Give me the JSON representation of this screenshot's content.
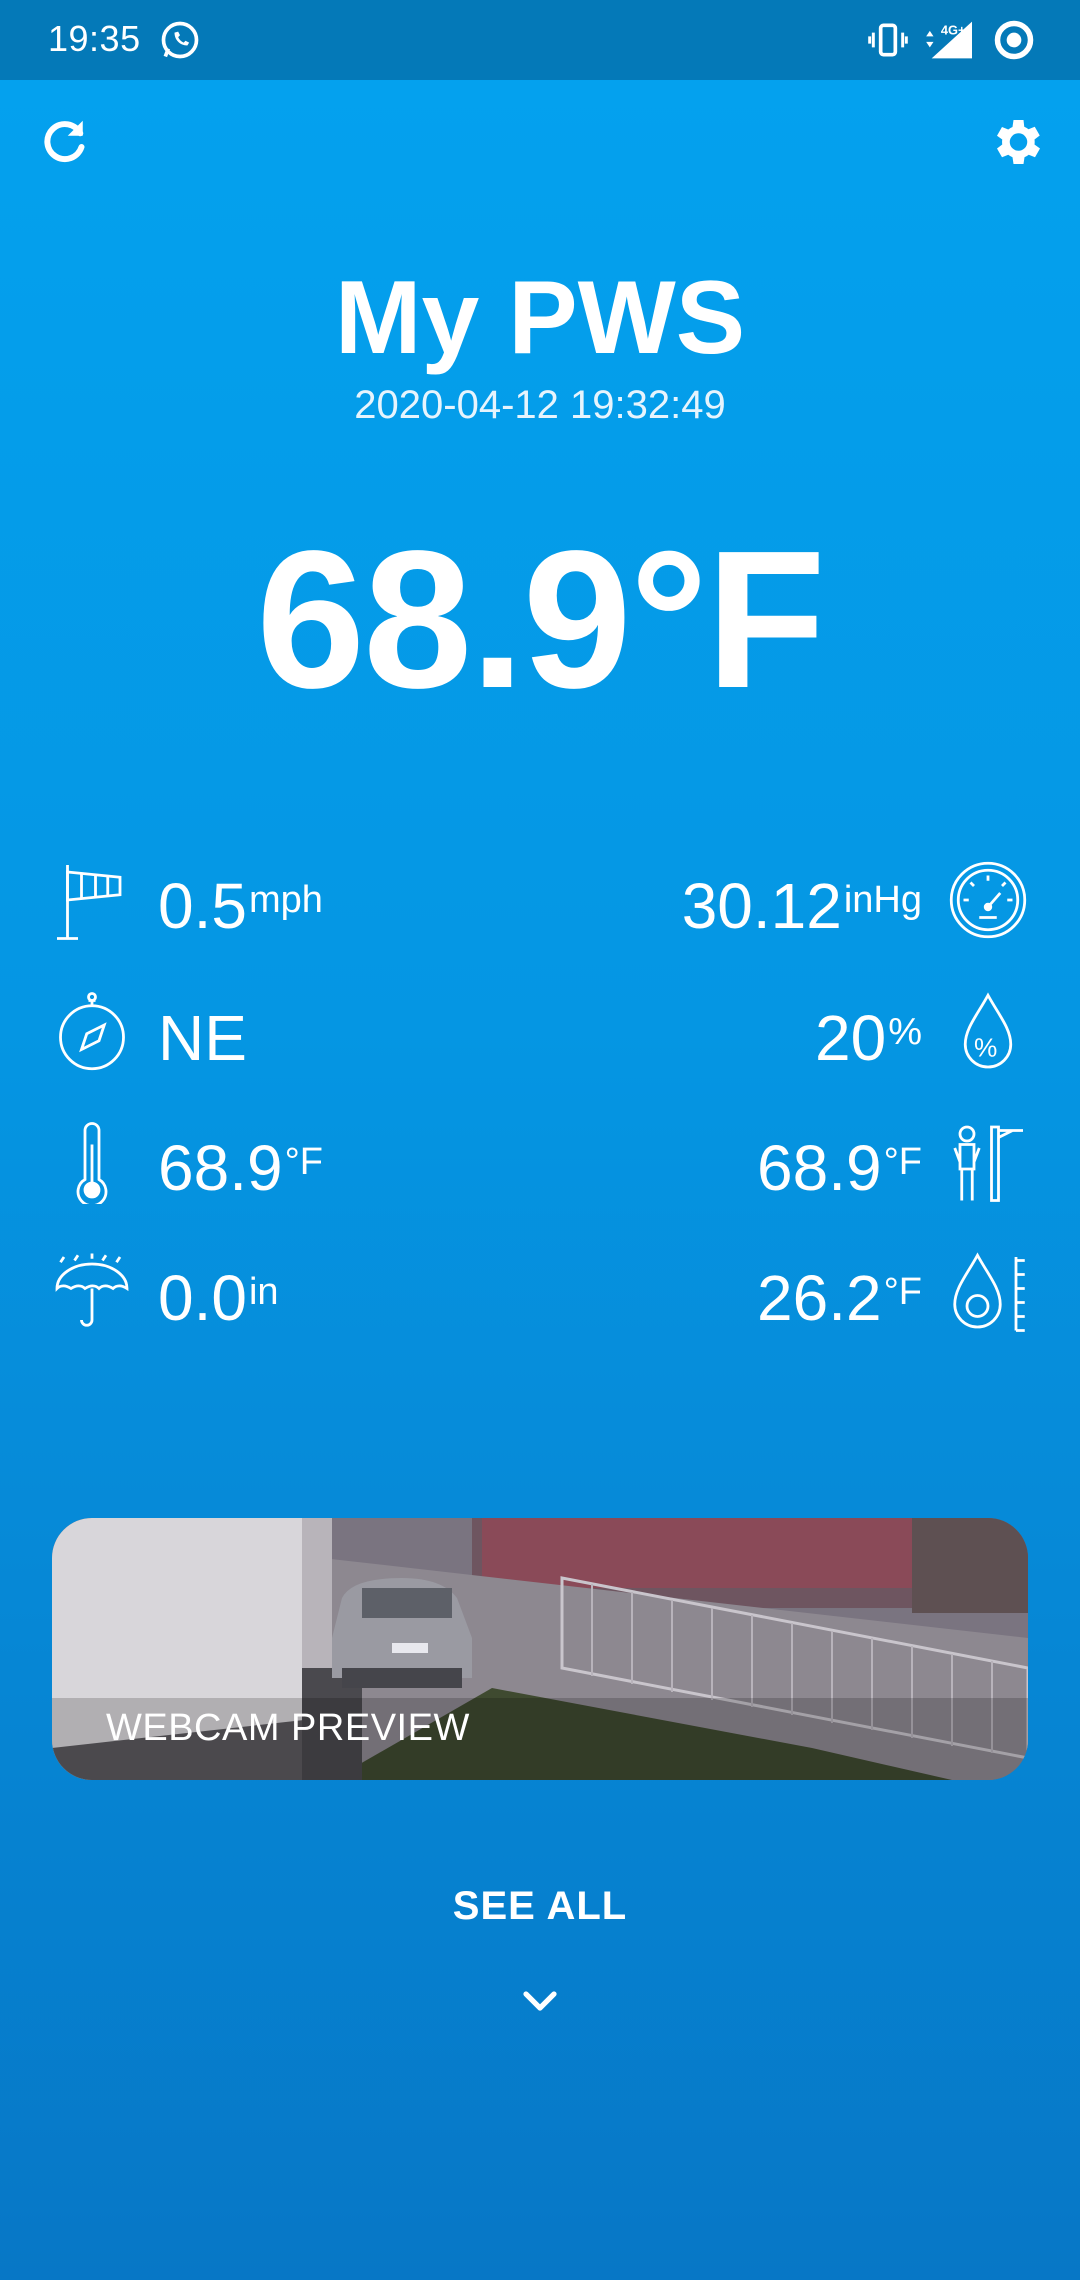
{
  "status_bar": {
    "time": "19:35",
    "icons": [
      "whatsapp-icon",
      "vibrate-icon",
      "signal-4g-icon",
      "sync-circle-icon"
    ],
    "network_label": "4G+"
  },
  "toolbar": {
    "refresh_icon": "refresh-icon",
    "settings_icon": "gear-icon"
  },
  "station": {
    "name": "My PWS",
    "timestamp": "2020-04-12 19:32:49",
    "temperature": "68.9°F"
  },
  "metrics": {
    "wind_speed": {
      "value": "0.5",
      "unit": "mph",
      "icon": "windsock-icon"
    },
    "pressure": {
      "value": "30.12",
      "unit": "inHg",
      "icon": "barometer-icon"
    },
    "wind_direction": {
      "value": "NE",
      "unit": "",
      "icon": "compass-icon"
    },
    "humidity": {
      "value": "20",
      "unit": "%",
      "icon": "humidity-drop-icon"
    },
    "temperature": {
      "value": "68.9",
      "unit": "°F",
      "icon": "thermometer-icon"
    },
    "feels_like": {
      "value": "68.9",
      "unit": "°F",
      "icon": "feels-like-icon"
    },
    "rain": {
      "value": "0.0",
      "unit": "in",
      "icon": "umbrella-rain-icon"
    },
    "dew_point": {
      "value": "26.2",
      "unit": "°F",
      "icon": "dew-point-icon"
    }
  },
  "webcam": {
    "label": "WEBCAM PREVIEW"
  },
  "see_all": {
    "label": "SEE ALL",
    "icon": "chevron-down-icon"
  },
  "colors": {
    "background_top": "#04a2ef",
    "background_bottom": "#0777c6",
    "status_bar": "#0479b8",
    "text": "#ffffff"
  }
}
